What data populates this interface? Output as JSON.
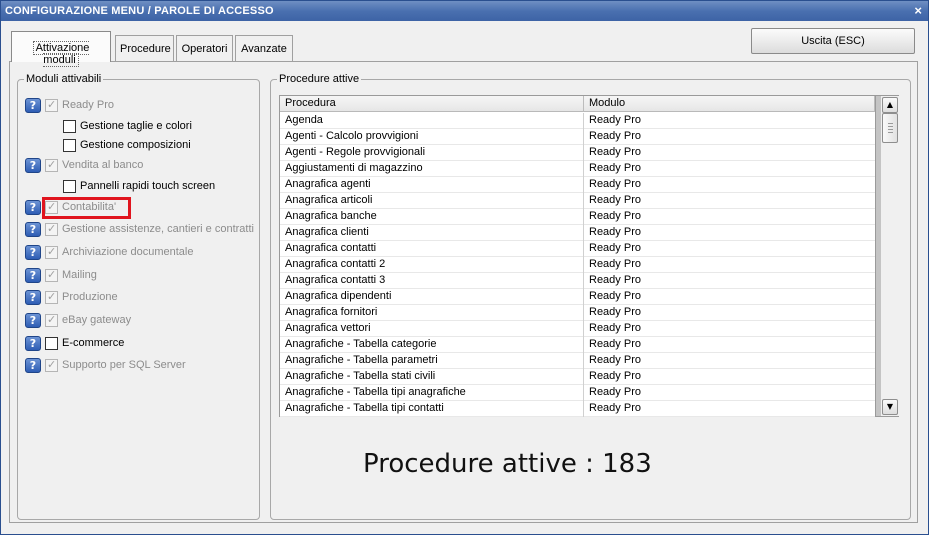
{
  "window": {
    "title": "CONFIGURAZIONE MENU / PAROLE DI ACCESSO",
    "close_glyph": "×"
  },
  "tabs": [
    {
      "label": "Attivazione moduli",
      "active": true
    },
    {
      "label": "Procedure",
      "active": false
    },
    {
      "label": "Operatori",
      "active": false
    },
    {
      "label": "Avanzate",
      "active": false
    }
  ],
  "exit_button": {
    "label": "Uscita (ESC)"
  },
  "modules_group": {
    "legend": "Moduli attivabili",
    "items": [
      {
        "label": "Ready Pro",
        "checked": true,
        "enabled": false,
        "help": true
      },
      {
        "label": "Gestione taglie e colori",
        "checked": false,
        "enabled": true,
        "help": false
      },
      {
        "label": "Gestione composizioni",
        "checked": false,
        "enabled": true,
        "help": false
      },
      {
        "label": "Vendita al banco",
        "checked": true,
        "enabled": false,
        "help": true
      },
      {
        "label": "Pannelli rapidi touch screen",
        "checked": false,
        "enabled": true,
        "help": false
      },
      {
        "label": "Contabilita'",
        "checked": true,
        "enabled": false,
        "help": true
      },
      {
        "label": "Gestione assistenze, cantieri e contratti",
        "checked": true,
        "enabled": false,
        "help": true
      },
      {
        "label": "Archiviazione documentale",
        "checked": true,
        "enabled": false,
        "help": true
      },
      {
        "label": "Mailing",
        "checked": true,
        "enabled": false,
        "help": true
      },
      {
        "label": "Produzione",
        "checked": true,
        "enabled": false,
        "help": true
      },
      {
        "label": "eBay gateway",
        "checked": true,
        "enabled": false,
        "help": true
      },
      {
        "label": "E-commerce",
        "checked": false,
        "enabled": true,
        "help": true
      },
      {
        "label": "Supporto per SQL Server",
        "checked": true,
        "enabled": false,
        "help": true
      }
    ],
    "help_glyph": "?",
    "highlight_color": "#e0141e"
  },
  "procedures_group": {
    "legend": "Procedure attive",
    "columns": [
      "Procedura",
      "Modulo"
    ],
    "rows": [
      [
        "Agenda",
        "Ready Pro"
      ],
      [
        "Agenti - Calcolo provvigioni",
        "Ready Pro"
      ],
      [
        "Agenti - Regole provvigionali",
        "Ready Pro"
      ],
      [
        "Aggiustamenti di magazzino",
        "Ready Pro"
      ],
      [
        "Anagrafica agenti",
        "Ready Pro"
      ],
      [
        "Anagrafica articoli",
        "Ready Pro"
      ],
      [
        "Anagrafica banche",
        "Ready Pro"
      ],
      [
        "Anagrafica clienti",
        "Ready Pro"
      ],
      [
        "Anagrafica contatti",
        "Ready Pro"
      ],
      [
        "Anagrafica contatti 2",
        "Ready Pro"
      ],
      [
        "Anagrafica contatti 3",
        "Ready Pro"
      ],
      [
        "Anagrafica dipendenti",
        "Ready Pro"
      ],
      [
        "Anagrafica fornitori",
        "Ready Pro"
      ],
      [
        "Anagrafica vettori",
        "Ready Pro"
      ],
      [
        "Anagrafiche - Tabella categorie",
        "Ready Pro"
      ],
      [
        "Anagrafiche - Tabella parametri",
        "Ready Pro"
      ],
      [
        "Anagrafiche - Tabella stati civili",
        "Ready Pro"
      ],
      [
        "Anagrafiche - Tabella tipi anagrafiche",
        "Ready Pro"
      ],
      [
        "Anagrafiche - Tabella tipi contatti",
        "Ready Pro"
      ]
    ],
    "scroll_up_glyph": "▲",
    "scroll_down_glyph": "▼",
    "count_text": "Procedure attive : 183"
  }
}
